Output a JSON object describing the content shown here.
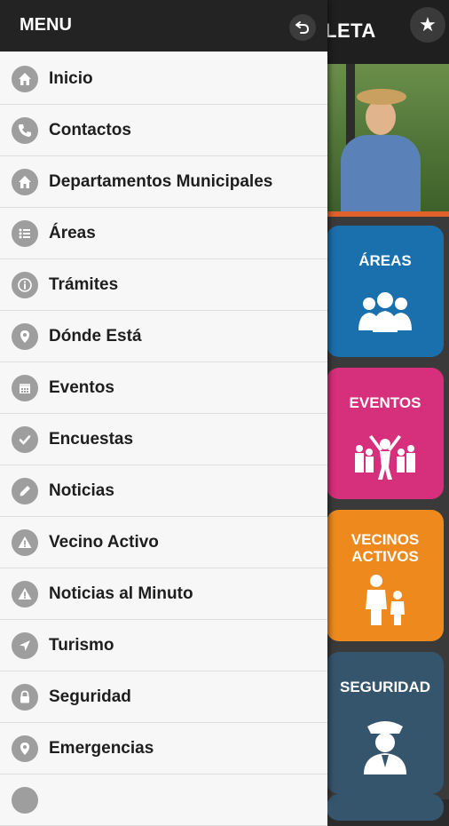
{
  "colors": {
    "drawer_bg": "#f4f4f4",
    "header_bg": "#232323",
    "icon_grey": "#9e9e9e",
    "tile_areas": "#1a6fad",
    "tile_eventos": "#d62f7b",
    "tile_vecinos": "#ee8a1d",
    "tile_seguridad": "#35556d"
  },
  "app": {
    "title_partial": "LETA",
    "star_icon": "star-icon"
  },
  "tiles": {
    "areas": "ÁREAS",
    "eventos": "EVENTOS",
    "vecinos_line1": "VECINOS",
    "vecinos_line2": "ACTIVOS",
    "seguridad": "SEGURIDAD"
  },
  "drawer": {
    "title": "MENU",
    "back_icon": "back-arrow-icon",
    "items": [
      {
        "label": "Inicio",
        "icon": "home-icon"
      },
      {
        "label": "Contactos",
        "icon": "phone-icon"
      },
      {
        "label": "Departamentos Municipales",
        "icon": "home-icon"
      },
      {
        "label": "Áreas",
        "icon": "list-icon"
      },
      {
        "label": "Trámites",
        "icon": "info-icon"
      },
      {
        "label": "Dónde Está",
        "icon": "map-pin-icon"
      },
      {
        "label": "Eventos",
        "icon": "calendar-icon"
      },
      {
        "label": "Encuestas",
        "icon": "check-icon"
      },
      {
        "label": "Noticias",
        "icon": "pencil-icon"
      },
      {
        "label": "Vecino Activo",
        "icon": "warning-icon"
      },
      {
        "label": "Noticias al Minuto",
        "icon": "warning-icon"
      },
      {
        "label": "Turismo",
        "icon": "navigation-arrow-icon"
      },
      {
        "label": "Seguridad",
        "icon": "lock-icon"
      },
      {
        "label": "Emergencias",
        "icon": "map-pin-icon"
      }
    ]
  }
}
